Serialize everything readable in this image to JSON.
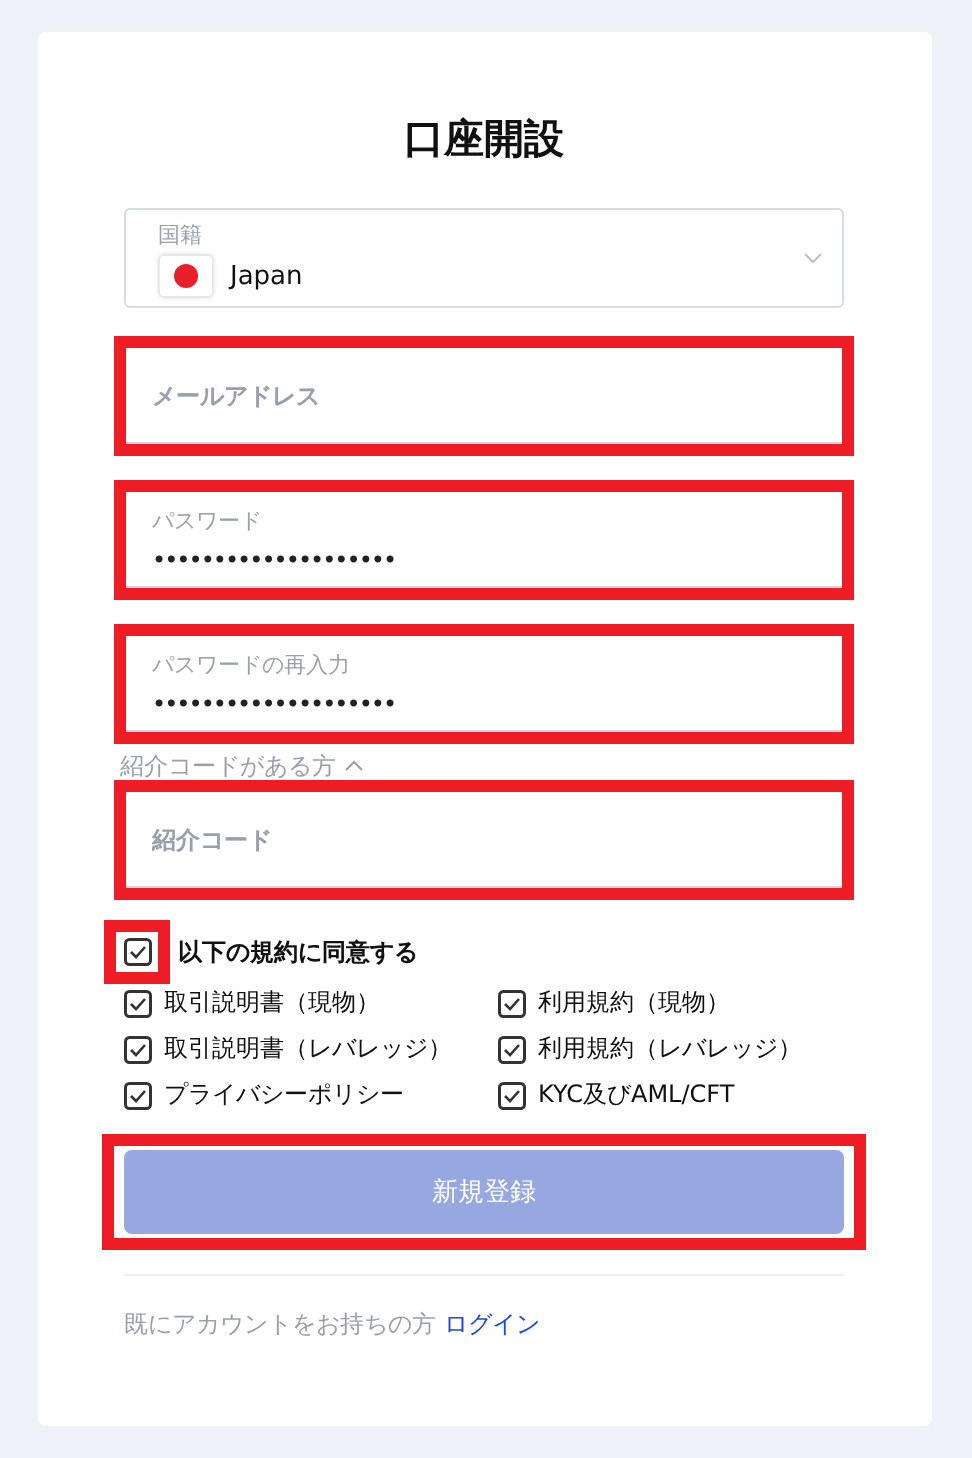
{
  "title": "口座開設",
  "country": {
    "label": "国籍",
    "value": "Japan"
  },
  "fields": [
    {
      "kind": "text",
      "placeholder": "メールアドレス",
      "highlighted": true
    },
    {
      "kind": "password",
      "label": "パスワード",
      "value": "••••••••••••••••••••",
      "highlighted": true
    },
    {
      "kind": "password",
      "label": "パスワードの再入力",
      "value": "••••••••••••••••••••",
      "highlighted": true
    },
    {
      "kind": "toggle",
      "label": "紹介コードがある方",
      "expanded": true
    },
    {
      "kind": "text",
      "placeholder": "紹介コード",
      "highlighted": true
    }
  ],
  "agree_all": {
    "label": "以下の規約に同意する",
    "checked": true,
    "highlighted": true
  },
  "terms": [
    {
      "label": "取引説明書（現物）",
      "checked": true
    },
    {
      "label": "利用規約（現物）",
      "checked": true
    },
    {
      "label": "取引説明書（レバレッジ）",
      "checked": true
    },
    {
      "label": "利用規約（レバレッジ）",
      "checked": true
    },
    {
      "label": "プライバシーポリシー",
      "checked": true
    },
    {
      "label": "KYC及びAML/CFT",
      "checked": true
    }
  ],
  "submit": {
    "label": "新規登録",
    "disabled": true,
    "highlighted": true
  },
  "footer": {
    "text": "既にアカウントをお持ちの方",
    "link": "ログイン"
  }
}
